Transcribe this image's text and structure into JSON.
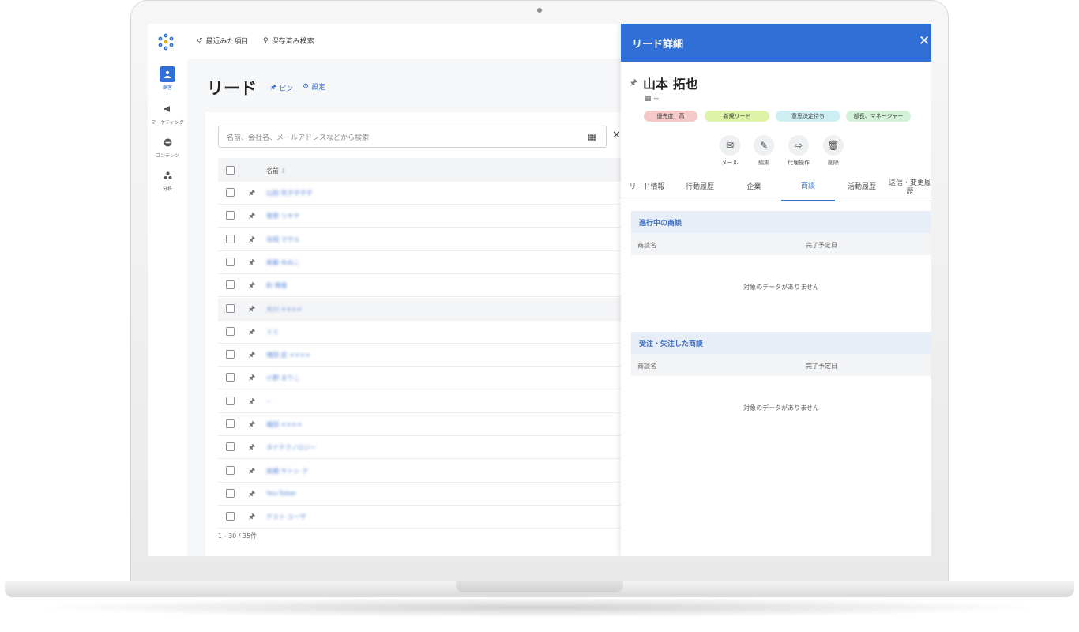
{
  "topbar": {
    "recent_label": "最近みた項目",
    "saved_search_label": "保存済み検索"
  },
  "nav": {
    "items": [
      {
        "label": "顧客",
        "icon": "person-icon",
        "active": true
      },
      {
        "label": "マーケティング",
        "icon": "megaphone-icon",
        "active": false
      },
      {
        "label": "コンテンツ",
        "icon": "content-icon",
        "active": false
      },
      {
        "label": "分析",
        "icon": "analytics-icon",
        "active": false
      }
    ]
  },
  "page": {
    "title": "リード",
    "pin_label": "ピン",
    "settings_label": "設定"
  },
  "list": {
    "search_placeholder": "名前、会社名、メールアドレスなどから検索",
    "column_name": "名前",
    "rows": [
      {
        "name": "山田 花子子子子"
      },
      {
        "name": "菅原 リキヤ"
      },
      {
        "name": "寺岡 マサル"
      },
      {
        "name": "斎藤 ゆみこ"
      },
      {
        "name": "鈴 晴香"
      },
      {
        "name": "大川 ××××"
      },
      {
        "name": "ミミ"
      },
      {
        "name": "増田 武 ××××"
      },
      {
        "name": "小野 まりこ"
      },
      {
        "name": "--"
      },
      {
        "name": "福田 ××××"
      },
      {
        "name": "タナテクノロジー"
      },
      {
        "name": "高橋 サトシ ク"
      },
      {
        "name": "You-Tuber"
      },
      {
        "name": "テスト ユーザ"
      }
    ],
    "footer": "1 - 30 / 35件"
  },
  "detail": {
    "header_title": "リード詳細",
    "person_name": "山本 拓也",
    "company": "--",
    "tags": [
      {
        "label": "優先度：高",
        "color": "#f6c9c9"
      },
      {
        "label": "新規リード",
        "color": "#def3a8"
      },
      {
        "label": "意思決定待ち",
        "color": "#cdeff2"
      },
      {
        "label": "部長、マネージャー",
        "color": "#d2f1d8"
      }
    ],
    "actions": [
      {
        "label": "メール",
        "icon": "mail-icon"
      },
      {
        "label": "編集",
        "icon": "pencil-icon"
      },
      {
        "label": "代理操作",
        "icon": "login-icon"
      },
      {
        "label": "削除",
        "icon": "trash-icon"
      }
    ],
    "tabs": [
      {
        "label": "リード情報"
      },
      {
        "label": "行動履歴"
      },
      {
        "label": "企業"
      },
      {
        "label": "商談"
      },
      {
        "label": "活動履歴"
      },
      {
        "label": "送信・変更履歴"
      }
    ],
    "active_tab": "商談",
    "sections": [
      {
        "title": "進行中の商談",
        "col_name": "商談名",
        "col_date": "完了予定日",
        "empty": "対象のデータがありません"
      },
      {
        "title": "受注・失注した商談",
        "col_name": "商談名",
        "col_date": "完了予定日",
        "empty": "対象のデータがありません"
      }
    ]
  }
}
